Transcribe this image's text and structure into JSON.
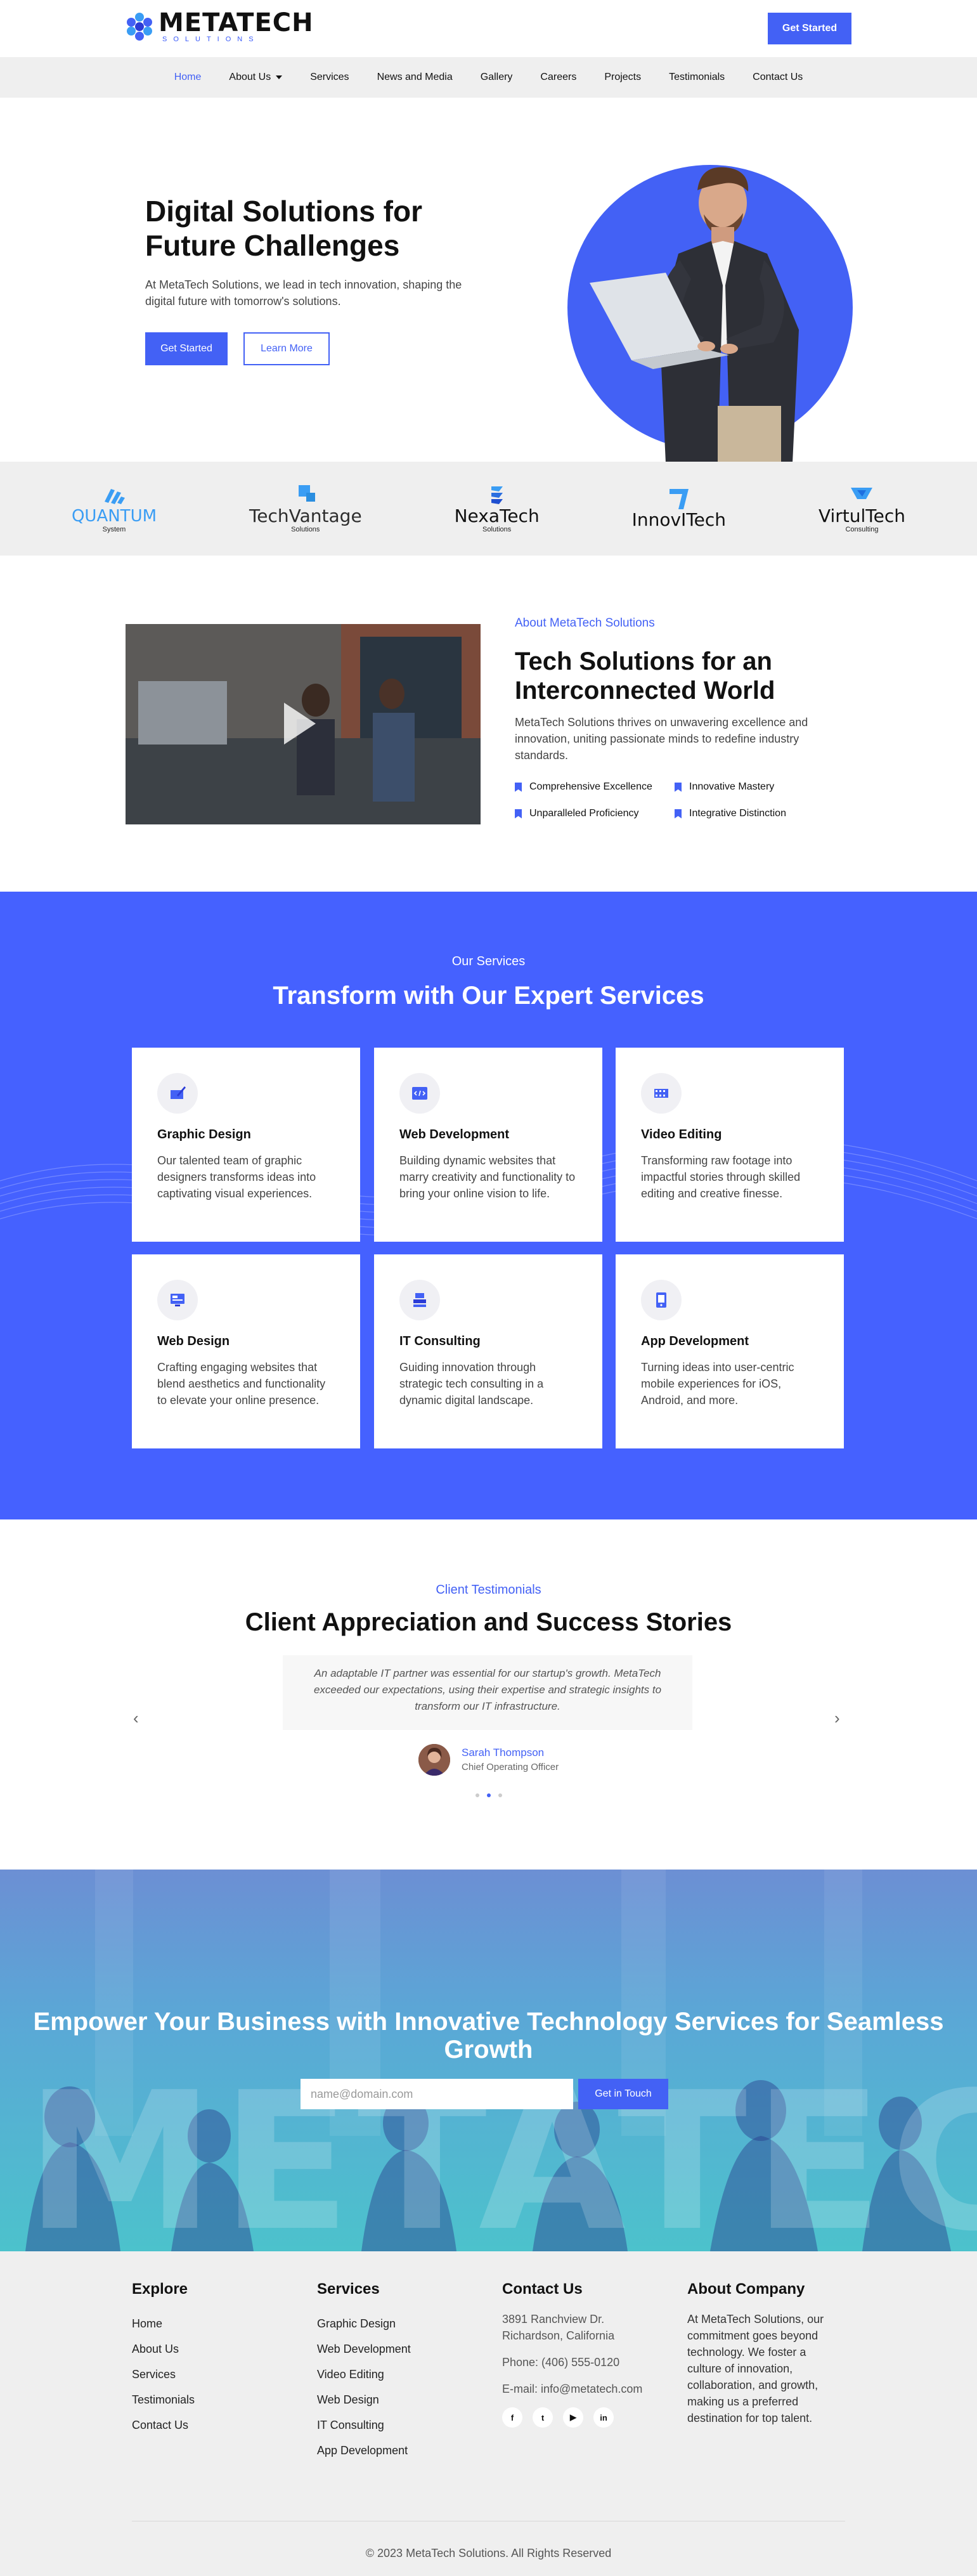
{
  "header": {
    "logo_name": "METATECH",
    "logo_sub": "SOLUTIONS",
    "cta_label": "Get Started"
  },
  "nav": {
    "items": [
      {
        "label": "Home",
        "active": true
      },
      {
        "label": "About Us",
        "dropdown": true
      },
      {
        "label": "Services"
      },
      {
        "label": "News and Media"
      },
      {
        "label": "Gallery"
      },
      {
        "label": "Careers"
      },
      {
        "label": "Projects"
      },
      {
        "label": "Testimonials"
      },
      {
        "label": "Contact Us"
      }
    ]
  },
  "hero": {
    "title": "Digital Solutions for Future Challenges",
    "text": "At MetaTech Solutions, we lead in tech innovation, shaping the digital future with tomorrow's solutions.",
    "primary_label": "Get Started",
    "secondary_label": "Learn More"
  },
  "brands": [
    {
      "name": "QUANTUM",
      "tag": "System",
      "color": "#3a9df4"
    },
    {
      "name": "TechVantage",
      "tag": "Solutions",
      "color": "#2d2d2d"
    },
    {
      "name": "NexaTech",
      "tag": "Solutions",
      "color": "#111"
    },
    {
      "name": "InnovITech",
      "tag": "",
      "color": "#111"
    },
    {
      "name": "VirtulTech",
      "tag": "Consulting",
      "color": "#111"
    }
  ],
  "about": {
    "kicker": "About MetaTech Solutions",
    "title": "Tech Solutions for an Interconnected World",
    "text": "MetaTech Solutions thrives on unwavering excellence and innovation, uniting passionate minds to redefine industry standards.",
    "features": [
      "Comprehensive Excellence",
      "Innovative Mastery",
      "Unparalleled Proficiency",
      "Integrative Distinction"
    ]
  },
  "services": {
    "kicker": "Our Services",
    "title": "Transform with Our Expert Services",
    "cards": [
      {
        "title": "Graphic Design",
        "text": "Our talented team of graphic designers transforms ideas into captivating visual experiences.",
        "icon": "pen-tablet-icon"
      },
      {
        "title": "Web Development",
        "text": "Building dynamic websites that marry creativity and functionality to bring your online vision to life.",
        "icon": "code-window-icon"
      },
      {
        "title": "Video Editing",
        "text": "Transforming raw footage into impactful stories through skilled editing and creative finesse.",
        "icon": "film-strip-icon"
      },
      {
        "title": "Web Design",
        "text": "Crafting engaging websites that blend aesthetics and functionality to elevate your online presence.",
        "icon": "monitor-design-icon"
      },
      {
        "title": "IT Consulting",
        "text": "Guiding innovation through strategic tech consulting in a dynamic digital landscape.",
        "icon": "server-icon"
      },
      {
        "title": "App Development",
        "text": "Turning ideas into user-centric mobile experiences for iOS, Android, and more.",
        "icon": "mobile-app-icon"
      }
    ]
  },
  "testimonials": {
    "kicker": "Client Testimonials",
    "title": "Client Appreciation and Success Stories",
    "quote": "An adaptable IT partner was essential for our startup's growth. MetaTech exceeded our expectations, using their expertise and strategic insights to transform our IT infrastructure.",
    "name": "Sarah Thompson",
    "role": "Chief Operating Officer"
  },
  "cta": {
    "title": "Empower Your Business with Innovative Technology Services for Seamless Growth",
    "bg_text": "METATECH",
    "placeholder": "name@domain.com",
    "button": "Get in Touch"
  },
  "footer": {
    "explore_title": "Explore",
    "explore": [
      "Home",
      "About Us",
      "Services",
      "Testimonials",
      "Contact Us"
    ],
    "services_title": "Services",
    "services": [
      "Graphic Design",
      "Web Development",
      "Video Editing",
      "Web Design",
      "IT Consulting",
      "App Development"
    ],
    "contact_title": "Contact Us",
    "address": "3891 Ranchview Dr. Richardson, California",
    "phone": "Phone: (406) 555-0120",
    "email": "E-mail: info@metatech.com",
    "social": [
      "facebook-icon",
      "twitter-icon",
      "youtube-icon",
      "linkedin-icon"
    ],
    "about_title": "About Company",
    "about_text": "At MetaTech Solutions, our commitment goes beyond technology. We foster a culture of innovation, collaboration, and growth, making us a preferred destination for top talent.",
    "copyright": "© 2023 MetaTech Solutions. All Rights Reserved"
  },
  "colors": {
    "accent": "#4361f5",
    "services_bg": "#4561ff",
    "footer_bg": "#efefef"
  }
}
